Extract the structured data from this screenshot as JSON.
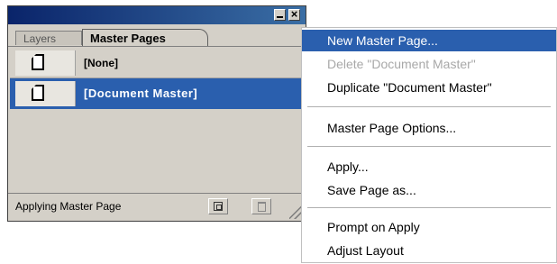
{
  "panel": {
    "tabs": {
      "layers": "Layers",
      "master_pages": "Master Pages"
    },
    "items": [
      {
        "label": "[None]"
      },
      {
        "label": "[Document Master]"
      }
    ],
    "status": "Applying Master Page"
  },
  "menu": {
    "items": [
      {
        "label": "New Master Page...",
        "state": "highlighted"
      },
      {
        "label": "Delete \"Document Master\"",
        "state": "disabled"
      },
      {
        "label": "Duplicate \"Document Master\"",
        "state": "normal"
      },
      {
        "label": "Master Page Options...",
        "state": "normal"
      },
      {
        "label": "Apply...",
        "state": "normal"
      },
      {
        "label": "Save Page as...",
        "state": "normal"
      },
      {
        "label": "Prompt on Apply",
        "state": "normal"
      },
      {
        "label": "Adjust Layout",
        "state": "normal"
      }
    ]
  },
  "colors": {
    "selection": "#2a5fae",
    "titlebar": "#0a246a",
    "panel_bg": "#d4d0c8"
  }
}
